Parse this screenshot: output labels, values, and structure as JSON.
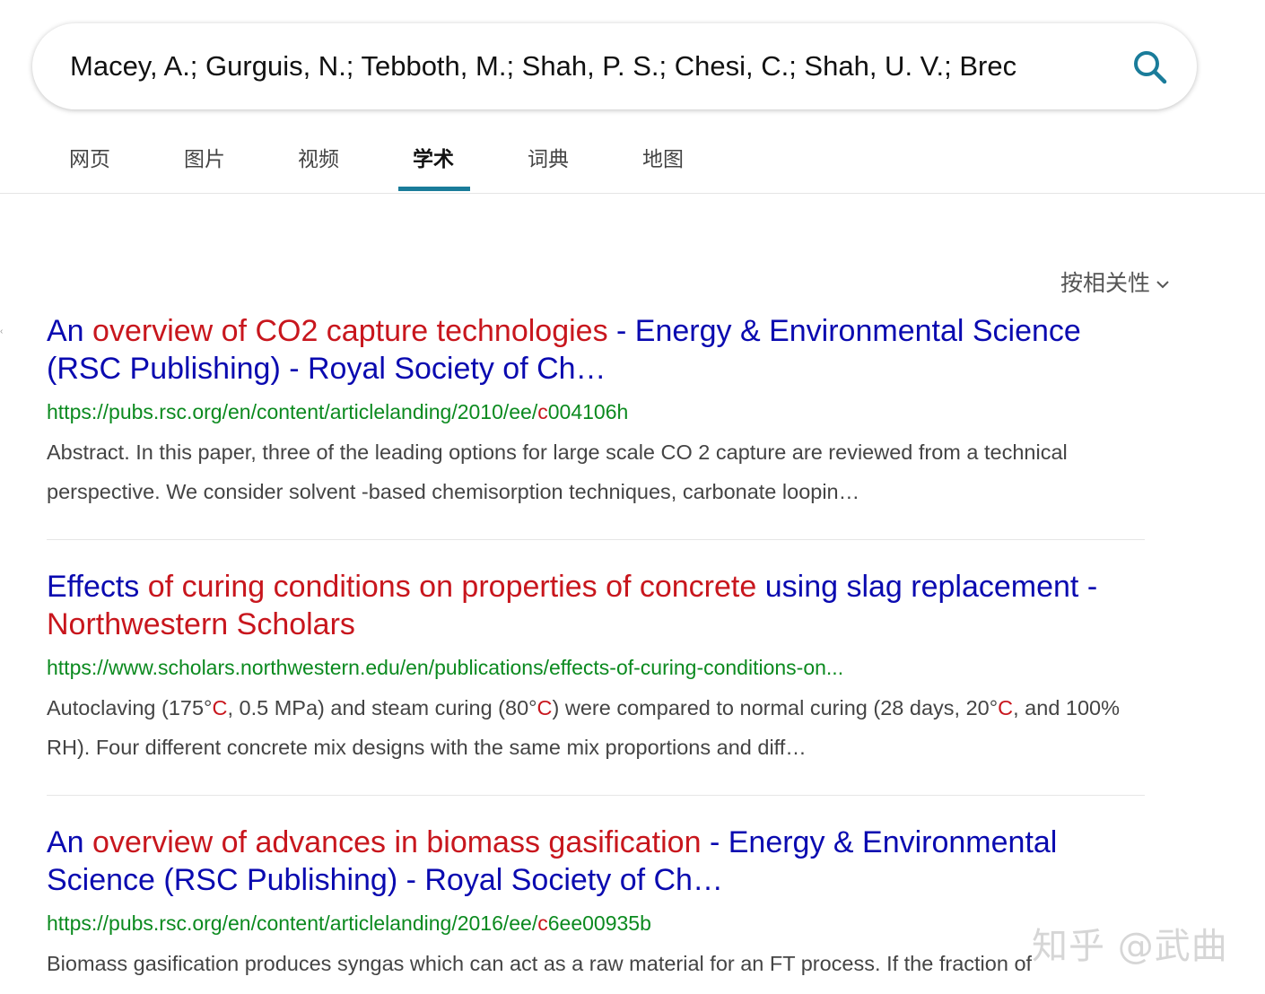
{
  "search": {
    "query": "Macey, A.; Gurguis, N.; Tebboth, M.; Shah, P. S.; Chesi, C.; Shah, U. V.; Brec",
    "icon": "search-icon",
    "accent": "#1a7c9a"
  },
  "tabs": [
    {
      "label": "网页"
    },
    {
      "label": "图片"
    },
    {
      "label": "视频"
    },
    {
      "label": "学术",
      "active": true
    },
    {
      "label": "词典"
    },
    {
      "label": "地图"
    }
  ],
  "sort": {
    "label": "按相关性",
    "icon": "chevron-down-icon"
  },
  "results": [
    {
      "title_parts": [
        {
          "text": "An ",
          "hl": false
        },
        {
          "text": "overview of CO2 capture technologies",
          "hl": true
        },
        {
          "text": " - Energy & Environmental Science (RSC Publishing) - Royal Society of Ch…",
          "hl": false
        }
      ],
      "url_parts": [
        {
          "text": "https://pubs.rsc.org/en/content/articlelanding/2010/ee/",
          "hl": false
        },
        {
          "text": "c",
          "hl": true
        },
        {
          "text": "004106h",
          "hl": false
        }
      ],
      "snippet_parts": [
        {
          "text": "Abstract. In this paper, three of the leading options for large scale CO 2 capture are reviewed from a technical perspective. We consider solvent -based chemisorption techniques, carbonate loopin…",
          "hl": false
        }
      ]
    },
    {
      "title_parts": [
        {
          "text": "Effects ",
          "hl": false
        },
        {
          "text": "of curing conditions on properties of concrete",
          "hl": true
        },
        {
          "text": " using slag replacement - ",
          "hl": false
        },
        {
          "text": "Northwestern Scholars",
          "hl": true
        }
      ],
      "url_parts": [
        {
          "text": "https://www.scholars.northwestern.edu/en/publications/effects-of-curing-conditions-on...",
          "hl": false
        }
      ],
      "snippet_parts": [
        {
          "text": "Autoclaving (175°",
          "hl": false
        },
        {
          "text": "C",
          "hl": true
        },
        {
          "text": ", 0.5 MPa) and steam curing (80°",
          "hl": false
        },
        {
          "text": "C",
          "hl": true
        },
        {
          "text": ") were compared to normal curing (28 days, 20°",
          "hl": false
        },
        {
          "text": "C",
          "hl": true
        },
        {
          "text": ", and 100% RH). Four different concrete mix designs with the same mix proportions and diff…",
          "hl": false
        }
      ]
    },
    {
      "title_parts": [
        {
          "text": "An ",
          "hl": false
        },
        {
          "text": "overview of advances in biomass gasification",
          "hl": true
        },
        {
          "text": " - Energy & Environmental Science (RSC Publishing) - Royal Society of Ch…",
          "hl": false
        }
      ],
      "url_parts": [
        {
          "text": "https://pubs.rsc.org/en/content/articlelanding/2016/ee/",
          "hl": false
        },
        {
          "text": "c",
          "hl": true
        },
        {
          "text": "6ee00935b",
          "hl": false
        }
      ],
      "snippet_parts": [
        {
          "text": "Biomass gasification produces syngas which can act as a raw material for an FT process. If the fraction of",
          "hl": false
        }
      ]
    }
  ],
  "colors": {
    "title": "#0a0ab0",
    "highlight": "#c8161d",
    "url": "#0b8a1f",
    "snippet": "#444444"
  },
  "watermark": "知乎 @武曲"
}
